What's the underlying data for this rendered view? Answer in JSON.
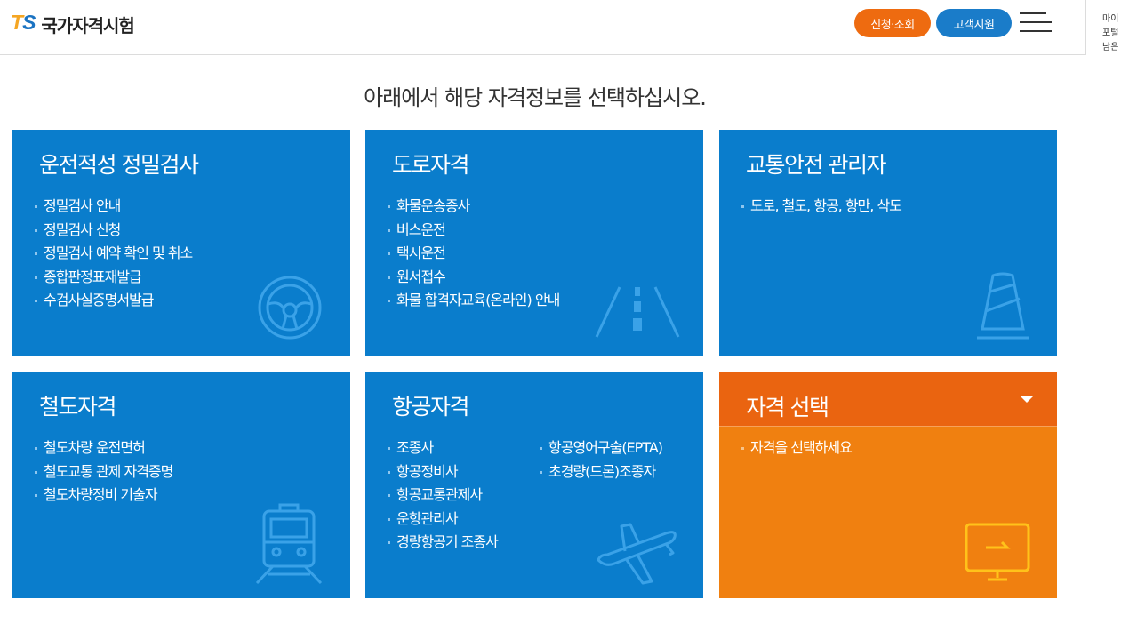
{
  "header": {
    "logo_mark": "TS",
    "logo_text": "국가자격시험",
    "apply_button": "신청·조회",
    "support_button": "고객지원",
    "side_panel_lines": [
      "마이",
      "포털",
      "남은"
    ]
  },
  "headline": "아래에서 해당 자격정보를 선택하십시오.",
  "colors": {
    "card_blue": "#0a7dcc",
    "card_orange": "#f08010",
    "apply_orange": "#ee6b10",
    "support_blue": "#1a7cc9"
  },
  "cards": {
    "aptitude": {
      "title": "운전적성 정밀검사",
      "icon": "steering-wheel-icon",
      "items": [
        "정밀검사 안내",
        "정밀검사 신청",
        "정밀검사 예약 확인 및 취소",
        "종합판정표재발급",
        "수검사실증명서발급"
      ]
    },
    "road": {
      "title": "도로자격",
      "icon": "road-icon",
      "items": [
        "화물운송종사",
        "버스운전",
        "택시운전",
        "원서접수",
        "화물 합격자교육(온라인) 안내"
      ]
    },
    "safety": {
      "title": "교통안전 관리자",
      "icon": "traffic-cone-icon",
      "items": [
        "도로, 철도, 항공, 항만, 삭도"
      ]
    },
    "rail": {
      "title": "철도자격",
      "icon": "train-icon",
      "items": [
        "철도차량 운전면허",
        "철도교통 관제 자격증명",
        "철도차량정비 기술자"
      ]
    },
    "aviation": {
      "title": "항공자격",
      "icon": "airplane-icon",
      "items_col1": [
        "조종사",
        "항공정비사",
        "항공교통관제사",
        "운항관리사",
        "경량항공기 조종사"
      ],
      "items_col2": [
        "항공영어구술(EPTA)",
        "초경량(드론)조종자"
      ]
    },
    "select": {
      "title": "자격 선택",
      "icon": "monitor-icon",
      "items": [
        "자격을 선택하세요"
      ]
    }
  }
}
